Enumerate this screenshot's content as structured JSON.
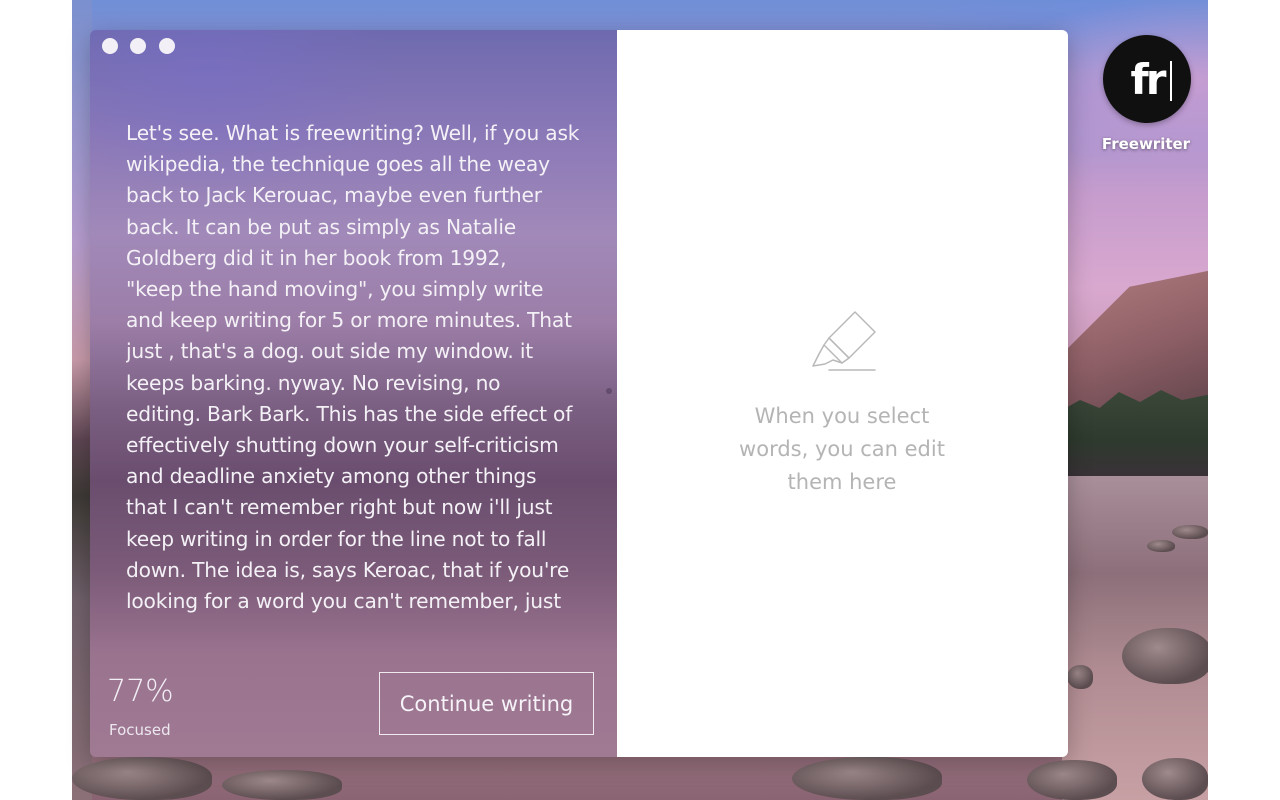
{
  "window": {
    "traffic_lights": [
      "close",
      "minimize",
      "zoom"
    ]
  },
  "editor": {
    "text": "Let's see. What is freewriting? Well, if you ask\nwikipedia, the technique goes all the weay\nback to Jack Kerouac, maybe even further\nback. It can be put as simply as Natalie\nGoldberg did it in her book from 1992,\n\"keep the hand  moving\", you simply write\nand keep writing for 5 or more minutes. That\njust , that's a dog. out side my window. it\nkeeps barking. nyway. No revising, no\nediting. Bark Bark. This has the side effect of\neffectively shutting down your self-criticism\nand deadline anxiety among other things\nthat I can't remember right but now i'll just\nkeep writing in order for the line not to fall\ndown. The idea is, says Keroac, that if you're\nlooking for a word you can't remember, just"
  },
  "focus": {
    "value": "77%",
    "label": "Focused"
  },
  "actions": {
    "continue_label": "Continue writing"
  },
  "inspector": {
    "icon": "highlighter-icon",
    "hint": "When you select words, you can edit them here"
  },
  "app": {
    "icon_mark": "fr",
    "name": "Freewriter"
  },
  "colors": {
    "editor_gradient_top": "#6e6aaf",
    "editor_gradient_bottom": "#a07a93",
    "editor_text": "#f4f1f6",
    "hint_text": "#b4b4b4",
    "app_icon_bg": "#101010"
  }
}
